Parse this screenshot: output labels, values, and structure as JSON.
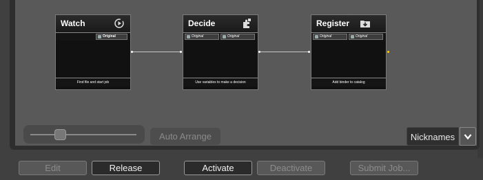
{
  "workflow": {
    "nodes": [
      {
        "title": "Watch",
        "icon": "play-circle-icon",
        "ports": [
          "Original"
        ],
        "footer": "Find file and start job"
      },
      {
        "title": "Decide",
        "icon": "puzzle-icon",
        "ports": [
          "Original",
          "Original"
        ],
        "footer": "Use variables to make a decision"
      },
      {
        "title": "Register",
        "icon": "folder-download-icon",
        "ports": [
          "Original",
          "Original"
        ],
        "footer": "Add binder to catalog"
      }
    ]
  },
  "controls": {
    "zoom_level": 0.25,
    "auto_arrange_label": "Auto Arrange",
    "nicknames_label": "Nicknames"
  },
  "toolbar": {
    "edit_label": "Edit",
    "release_label": "Release",
    "activate_label": "Activate",
    "deactivate_label": "Deactivate",
    "submit_label": "Submit Job..."
  },
  "colors": {
    "background": "#404040",
    "canvas": "#595959",
    "node_body": "#111111",
    "output_indicator": "#ffd400"
  }
}
